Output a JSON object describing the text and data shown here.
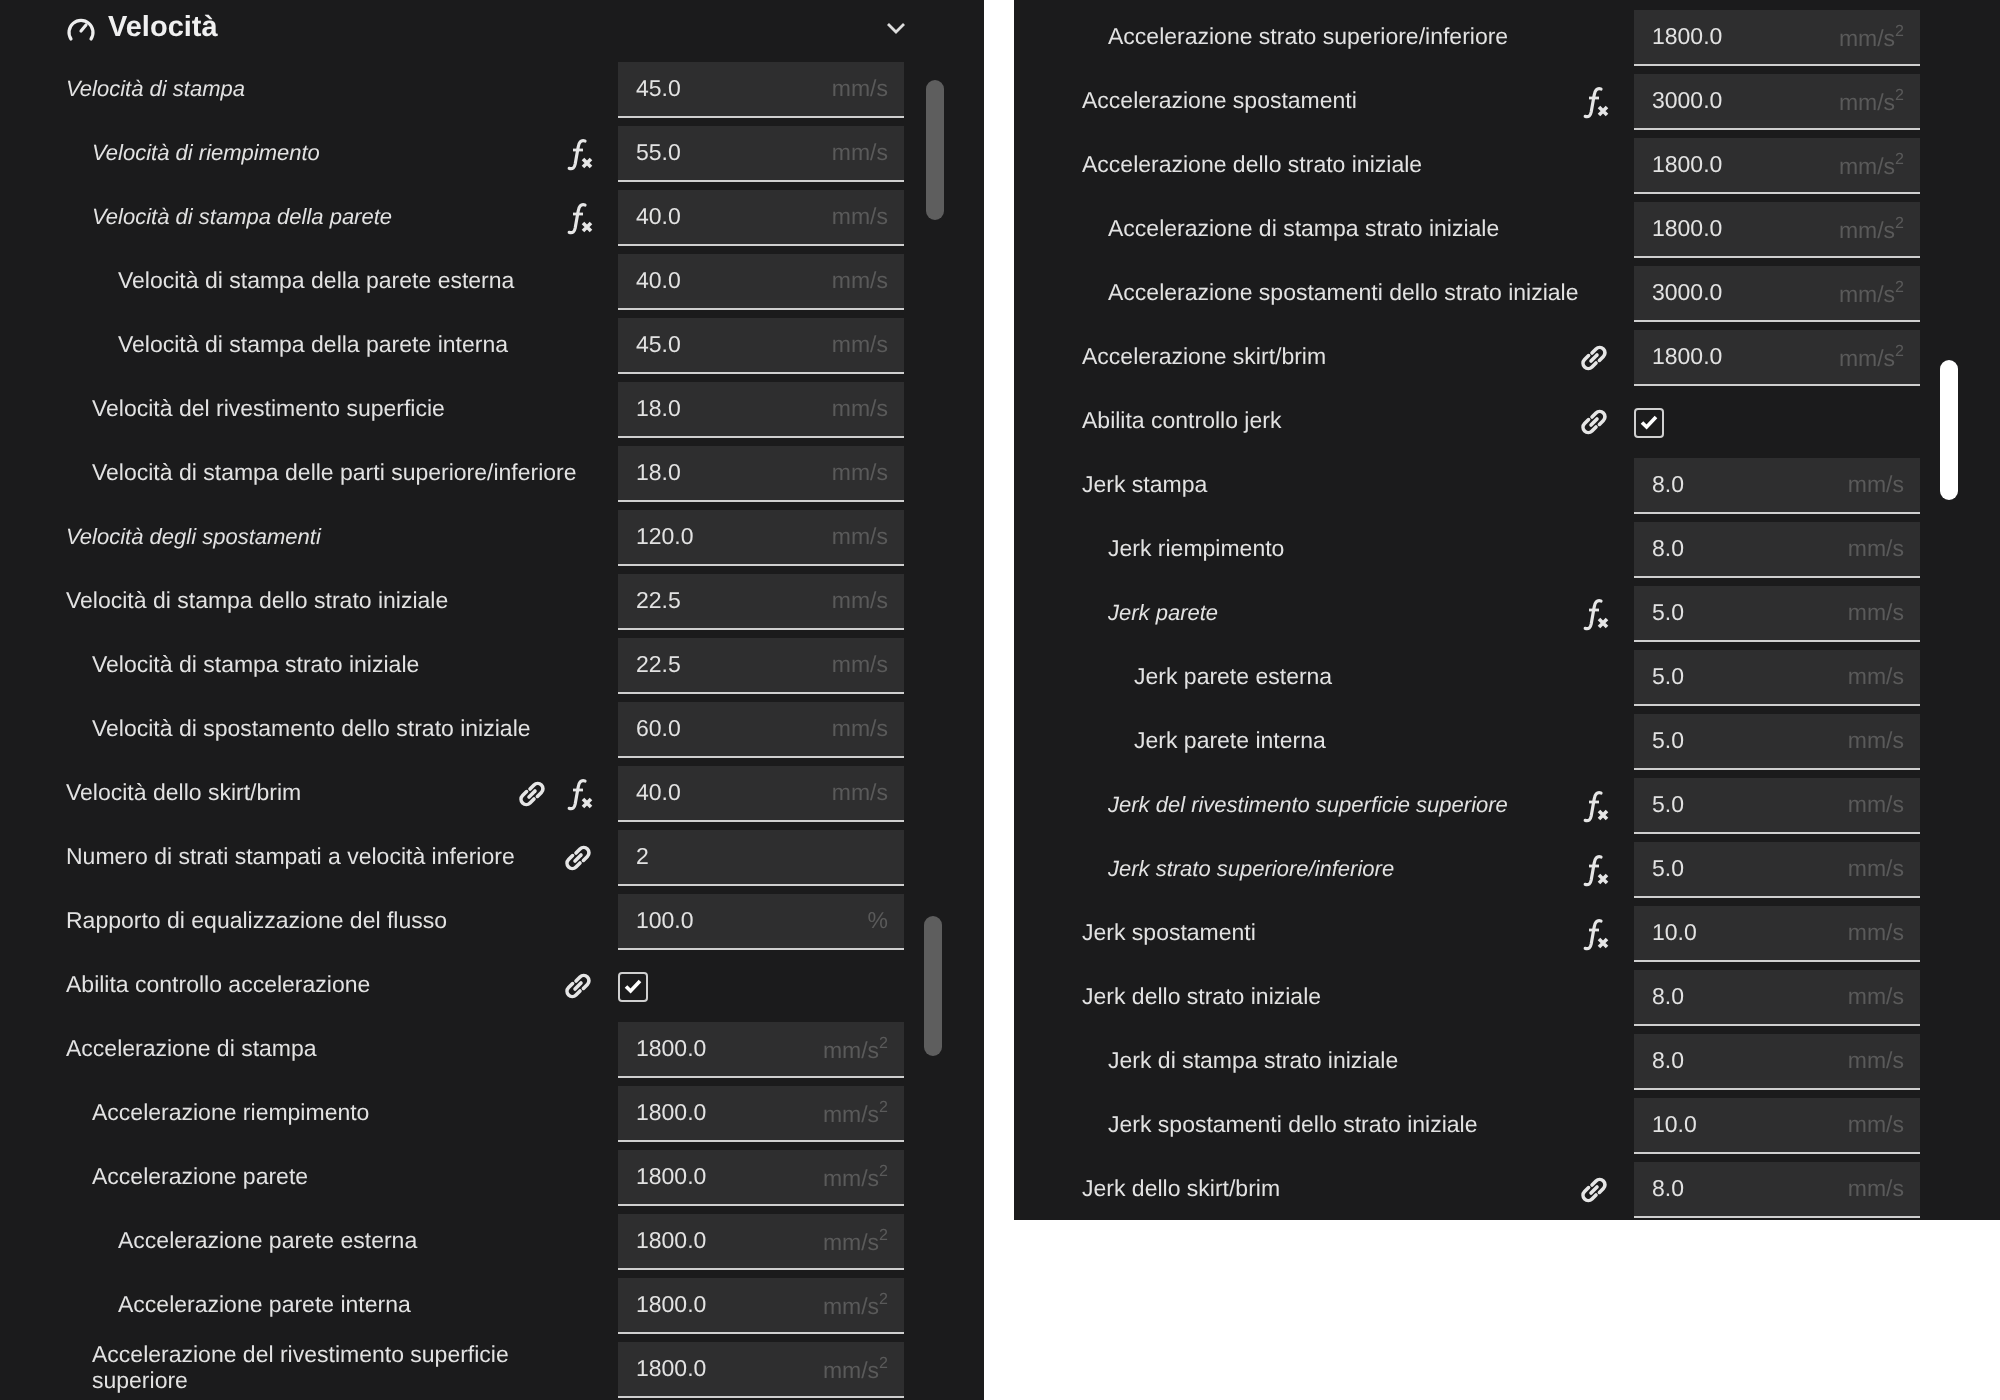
{
  "left_panel": {
    "section": {
      "title": "Velocità",
      "expanded": true
    },
    "settings": [
      {
        "label": "Velocità di stampa",
        "italic": true,
        "linked": false,
        "formula": false,
        "kind": "number",
        "value": "45.0",
        "unit": "mm/s",
        "children": [
          {
            "label": "Velocità di riempimento",
            "italic": true,
            "linked": false,
            "formula": true,
            "kind": "number",
            "value": "55.0",
            "unit": "mm/s"
          },
          {
            "label": "Velocità di stampa della parete",
            "italic": true,
            "linked": false,
            "formula": true,
            "kind": "number",
            "value": "40.0",
            "unit": "mm/s",
            "children": [
              {
                "label": "Velocità di stampa della parete esterna",
                "italic": false,
                "linked": false,
                "formula": false,
                "kind": "number",
                "value": "40.0",
                "unit": "mm/s"
              },
              {
                "label": "Velocità di stampa della parete interna",
                "italic": false,
                "linked": false,
                "formula": false,
                "kind": "number",
                "value": "45.0",
                "unit": "mm/s"
              }
            ]
          },
          {
            "label": "Velocità del rivestimento superficie",
            "italic": false,
            "linked": false,
            "formula": false,
            "kind": "number",
            "value": "18.0",
            "unit": "mm/s"
          },
          {
            "label": "Velocità di stampa delle parti superiore/inferiore",
            "italic": false,
            "linked": false,
            "formula": false,
            "kind": "number",
            "value": "18.0",
            "unit": "mm/s"
          }
        ]
      },
      {
        "label": "Velocità degli spostamenti",
        "italic": true,
        "linked": false,
        "formula": false,
        "kind": "number",
        "value": "120.0",
        "unit": "mm/s"
      },
      {
        "label": "Velocità di stampa dello strato iniziale",
        "italic": false,
        "linked": false,
        "formula": false,
        "kind": "number",
        "value": "22.5",
        "unit": "mm/s",
        "children": [
          {
            "label": "Velocità di stampa strato iniziale",
            "italic": false,
            "linked": false,
            "formula": false,
            "kind": "number",
            "value": "22.5",
            "unit": "mm/s"
          },
          {
            "label": "Velocità di spostamento dello strato iniziale",
            "italic": false,
            "linked": false,
            "formula": false,
            "kind": "number",
            "value": "60.0",
            "unit": "mm/s"
          }
        ]
      },
      {
        "label": "Velocità dello skirt/brim",
        "italic": false,
        "linked": true,
        "formula": true,
        "kind": "number",
        "value": "40.0",
        "unit": "mm/s"
      },
      {
        "label": "Numero di strati stampati a velocità inferiore",
        "italic": false,
        "linked": true,
        "formula": false,
        "kind": "number",
        "value": "2"
      },
      {
        "label": "Rapporto di equalizzazione del flusso",
        "italic": false,
        "linked": false,
        "formula": false,
        "kind": "number",
        "value": "100.0",
        "unit": "%"
      },
      {
        "label": "Abilita controllo accelerazione",
        "italic": false,
        "linked": true,
        "formula": false,
        "kind": "checkbox",
        "checked": true
      },
      {
        "label": "Accelerazione di stampa",
        "italic": false,
        "linked": false,
        "formula": false,
        "kind": "number",
        "value": "1800.0",
        "unit": "mm/s$^{2}$",
        "children": [
          {
            "label": "Accelerazione riempimento",
            "italic": false,
            "linked": false,
            "formula": false,
            "kind": "number",
            "value": "1800.0",
            "unit": "mm/s$^{2}$"
          },
          {
            "label": "Accelerazione parete",
            "italic": false,
            "linked": false,
            "formula": false,
            "kind": "number",
            "value": "1800.0",
            "unit": "mm/s$^{2}$",
            "children": [
              {
                "label": "Accelerazione parete esterna",
                "italic": false,
                "linked": false,
                "formula": false,
                "kind": "number",
                "value": "1800.0",
                "unit": "mm/s$^{2}$"
              },
              {
                "label": "Accelerazione parete interna",
                "italic": false,
                "linked": false,
                "formula": false,
                "kind": "number",
                "value": "1800.0",
                "unit": "mm/s$^{2}$"
              }
            ]
          },
          {
            "label": "Accelerazione del rivestimento superficie superiore",
            "italic": false,
            "linked": false,
            "formula": false,
            "kind": "number",
            "value": "1800.0",
            "unit": "mm/s$^{2}$"
          }
        ]
      }
    ]
  },
  "right_panel": {
    "continued_children": [
      {
        "label": "Accelerazione strato superiore/inferiore",
        "italic": false,
        "linked": false,
        "formula": false,
        "kind": "number",
        "value": "1800.0",
        "unit": "mm/s$^{2}$"
      }
    ],
    "settings": [
      {
        "label": "Accelerazione spostamenti",
        "italic": false,
        "linked": false,
        "formula": true,
        "kind": "number",
        "value": "3000.0",
        "unit": "mm/s$^{2}$"
      },
      {
        "label": "Accelerazione dello strato iniziale",
        "italic": false,
        "linked": false,
        "formula": false,
        "kind": "number",
        "value": "1800.0",
        "unit": "mm/s$^{2}$",
        "children": [
          {
            "label": "Accelerazione di stampa strato iniziale",
            "italic": false,
            "linked": false,
            "formula": false,
            "kind": "number",
            "value": "1800.0",
            "unit": "mm/s$^{2}$"
          },
          {
            "label": "Accelerazione spostamenti dello strato iniziale",
            "italic": false,
            "linked": false,
            "formula": false,
            "kind": "number",
            "value": "3000.0",
            "unit": "mm/s$^{2}$"
          }
        ]
      },
      {
        "label": "Accelerazione skirt/brim",
        "italic": false,
        "linked": true,
        "formula": false,
        "kind": "number",
        "value": "1800.0",
        "unit": "mm/s$^{2}$"
      },
      {
        "label": "Abilita controllo jerk",
        "italic": false,
        "linked": true,
        "formula": false,
        "kind": "checkbox",
        "checked": true
      },
      {
        "label": "Jerk stampa",
        "italic": false,
        "linked": false,
        "formula": false,
        "kind": "number",
        "value": "8.0",
        "unit": "mm/s",
        "children": [
          {
            "label": "Jerk riempimento",
            "italic": false,
            "linked": false,
            "formula": false,
            "kind": "number",
            "value": "8.0",
            "unit": "mm/s"
          },
          {
            "label": "Jerk parete",
            "italic": true,
            "linked": false,
            "formula": true,
            "kind": "number",
            "value": "5.0",
            "unit": "mm/s",
            "children": [
              {
                "label": "Jerk parete esterna",
                "italic": false,
                "linked": false,
                "formula": false,
                "kind": "number",
                "value": "5.0",
                "unit": "mm/s"
              },
              {
                "label": "Jerk parete interna",
                "italic": false,
                "linked": false,
                "formula": false,
                "kind": "number",
                "value": "5.0",
                "unit": "mm/s"
              }
            ]
          },
          {
            "label": "Jerk del rivestimento superficie superiore",
            "italic": true,
            "linked": false,
            "formula": true,
            "kind": "number",
            "value": "5.0",
            "unit": "mm/s"
          },
          {
            "label": "Jerk strato superiore/inferiore",
            "italic": true,
            "linked": false,
            "formula": true,
            "kind": "number",
            "value": "5.0",
            "unit": "mm/s"
          }
        ]
      },
      {
        "label": "Jerk spostamenti",
        "italic": false,
        "linked": false,
        "formula": true,
        "kind": "number",
        "value": "10.0",
        "unit": "mm/s"
      },
      {
        "label": "Jerk dello strato iniziale",
        "italic": false,
        "linked": false,
        "formula": false,
        "kind": "number",
        "value": "8.0",
        "unit": "mm/s",
        "children": [
          {
            "label": "Jerk di stampa strato iniziale",
            "italic": false,
            "linked": false,
            "formula": false,
            "kind": "number",
            "value": "8.0",
            "unit": "mm/s"
          },
          {
            "label": "Jerk spostamenti dello strato iniziale",
            "italic": false,
            "linked": false,
            "formula": false,
            "kind": "number",
            "value": "10.0",
            "unit": "mm/s"
          }
        ]
      },
      {
        "label": "Jerk dello skirt/brim",
        "italic": false,
        "linked": true,
        "formula": false,
        "kind": "number",
        "value": "8.0",
        "unit": "mm/s"
      }
    ]
  }
}
